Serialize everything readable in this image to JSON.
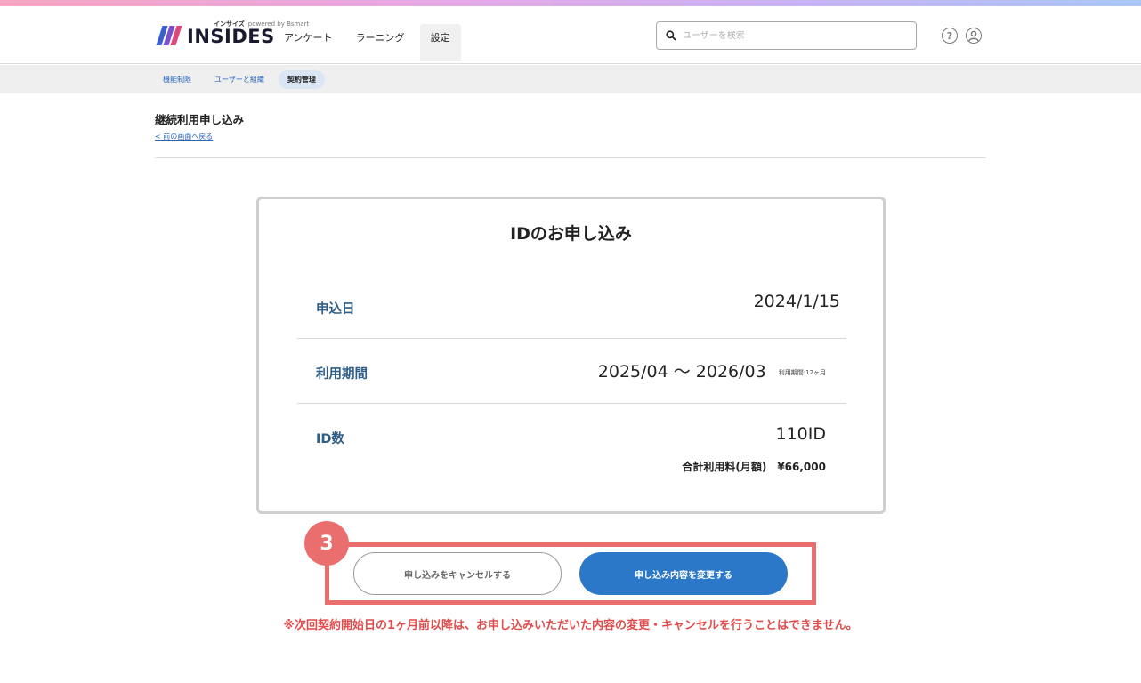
{
  "header": {
    "logo_small": "インサイズ",
    "logo_small_sub": "powered by Bsmart",
    "logo_text": "INSIDES",
    "nav": [
      {
        "label": "アンケート"
      },
      {
        "label": "ラーニング"
      },
      {
        "label": "設定"
      }
    ],
    "search_placeholder": "ユーザーを検索",
    "help_glyph": "?",
    "user_glyph": "👤"
  },
  "subnav": {
    "items": [
      {
        "label": "機能制限"
      },
      {
        "label": "ユーザーと組織"
      },
      {
        "label": "契約管理"
      }
    ]
  },
  "page": {
    "title": "継続利用申し込み",
    "back_link": "< 前の画面へ戻る"
  },
  "card": {
    "title": "IDのお申し込み",
    "rows": [
      {
        "label": "申込日",
        "value": "2024/1/15"
      },
      {
        "label": "利用期間",
        "value": "2025/04 〜 2026/03",
        "note": "利用期間:12ヶ月"
      },
      {
        "label": "ID数",
        "value": "110ID"
      }
    ],
    "fee": "合計利用料(月額)　¥66,000"
  },
  "step_badge": "3",
  "buttons": {
    "cancel": "申し込みをキャンセルする",
    "change": "申し込み内容を変更する"
  },
  "notice": "※次回契約開始日の1ヶ月前以降は、お申し込みいただいた内容の変更・キャンセルを行うことはできません。",
  "colors": {
    "accent": "#2c78c8",
    "highlight": "#ea6e6e",
    "notice": "#e24b4b",
    "label": "#2e5e86"
  }
}
